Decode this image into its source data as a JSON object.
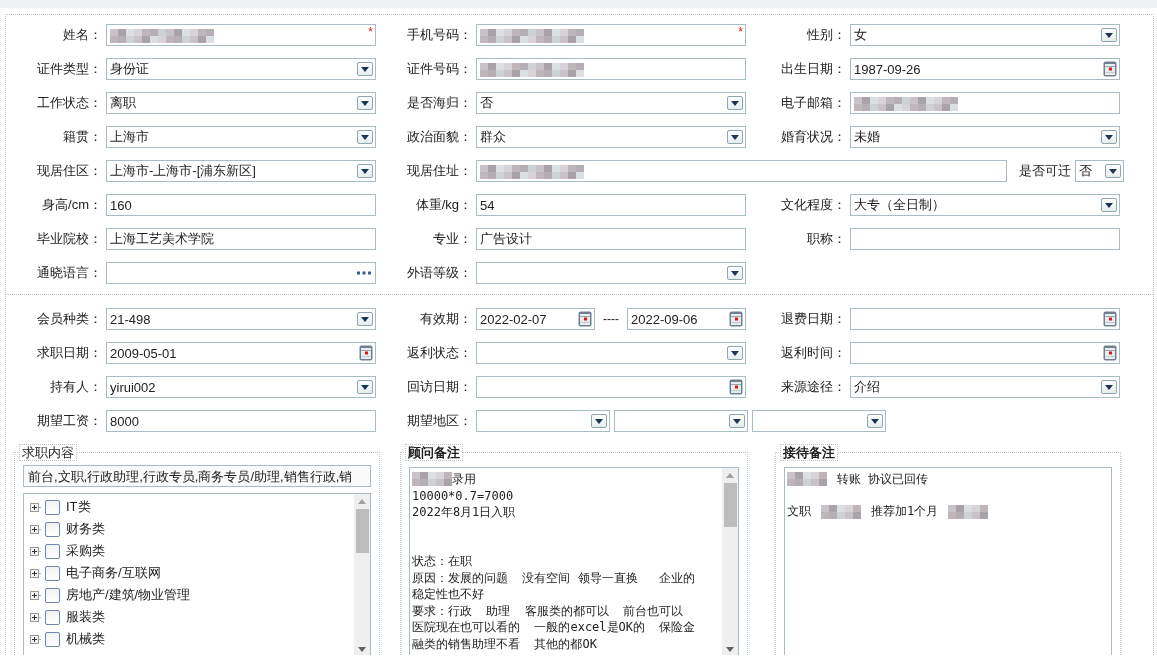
{
  "form_sections": [
    {
      "rows": [
        [
          {
            "label": "姓名：",
            "fields": [
              {
                "kind": "text",
                "redacted": true,
                "required_mark": "*"
              }
            ]
          },
          {
            "label": "手机号码：",
            "fields": [
              {
                "kind": "text",
                "redacted": true,
                "required_mark": "*"
              }
            ]
          },
          {
            "label": "性别：",
            "fields": [
              {
                "kind": "select",
                "value": "女"
              }
            ]
          }
        ],
        [
          {
            "label": "证件类型：",
            "fields": [
              {
                "kind": "select",
                "value": "身份证"
              }
            ]
          },
          {
            "label": "证件号码：",
            "fields": [
              {
                "kind": "text",
                "redacted": true
              }
            ]
          },
          {
            "label": "出生日期：",
            "fields": [
              {
                "kind": "date",
                "value": "1987-09-26"
              }
            ]
          }
        ],
        [
          {
            "label": "工作状态：",
            "fields": [
              {
                "kind": "select",
                "value": "离职"
              }
            ]
          },
          {
            "label": "是否海归：",
            "fields": [
              {
                "kind": "select",
                "value": "否"
              }
            ]
          },
          {
            "label": "电子邮箱：",
            "fields": [
              {
                "kind": "text",
                "redacted": true
              }
            ]
          }
        ],
        [
          {
            "label": "籍贯：",
            "fields": [
              {
                "kind": "select",
                "value": "上海市"
              }
            ]
          },
          {
            "label": "政治面貌：",
            "fields": [
              {
                "kind": "select",
                "value": "群众"
              }
            ]
          },
          {
            "label": "婚育状况：",
            "fields": [
              {
                "kind": "select",
                "value": "未婚"
              }
            ]
          }
        ],
        [
          {
            "label": "现居住区：",
            "fields": [
              {
                "kind": "select",
                "value": "上海市-上海市-[浦东新区]"
              }
            ]
          },
          {
            "label": "现居住址：",
            "fields": [
              {
                "kind": "text",
                "redacted": true
              }
            ],
            "trailing": {
              "label": "是否可迁",
              "fields": [
                {
                  "kind": "select",
                  "value": "否"
                }
              ]
            }
          }
        ],
        [
          {
            "label": "身高/cm：",
            "fields": [
              {
                "kind": "text",
                "value": "160"
              }
            ]
          },
          {
            "label": "体重/kg：",
            "fields": [
              {
                "kind": "text",
                "value": "54"
              }
            ]
          },
          {
            "label": "文化程度：",
            "fields": [
              {
                "kind": "select",
                "value": "大专（全日制）"
              }
            ]
          }
        ],
        [
          {
            "label": "毕业院校：",
            "fields": [
              {
                "kind": "text",
                "value": "上海工艺美术学院"
              }
            ]
          },
          {
            "label": "专业：",
            "fields": [
              {
                "kind": "text",
                "value": "广告设计"
              }
            ]
          },
          {
            "label": "职称：",
            "fields": [
              {
                "kind": "text"
              }
            ]
          }
        ],
        [
          {
            "label": "通晓语言：",
            "fields": [
              {
                "kind": "picker"
              }
            ]
          },
          {
            "label": "外语等级：",
            "fields": [
              {
                "kind": "select"
              }
            ]
          }
        ]
      ]
    },
    {
      "rows": [
        [
          {
            "label": "会员种类：",
            "fields": [
              {
                "kind": "select",
                "value": "21-498"
              }
            ]
          },
          {
            "label": "有效期：",
            "fields": [
              {
                "kind": "date",
                "value": "2022-02-07"
              },
              {
                "kind": "separator",
                "value": "----"
              },
              {
                "kind": "date",
                "value": "2022-09-06"
              }
            ]
          },
          {
            "label": "退费日期：",
            "fields": [
              {
                "kind": "date"
              }
            ]
          }
        ],
        [
          {
            "label": "求职日期：",
            "fields": [
              {
                "kind": "date",
                "value": "2009-05-01"
              }
            ]
          },
          {
            "label": "返利状态：",
            "fields": [
              {
                "kind": "select"
              }
            ]
          },
          {
            "label": "返利时间：",
            "fields": [
              {
                "kind": "date"
              }
            ]
          }
        ],
        [
          {
            "label": "持有人：",
            "fields": [
              {
                "kind": "select",
                "value": "yirui002"
              }
            ]
          },
          {
            "label": "回访日期：",
            "fields": [
              {
                "kind": "date"
              }
            ]
          },
          {
            "label": "来源途径：",
            "fields": [
              {
                "kind": "select",
                "value": "介绍"
              }
            ]
          }
        ],
        [
          {
            "label": "期望工资：",
            "fields": [
              {
                "kind": "text",
                "value": "8000"
              }
            ]
          },
          {
            "label": "期望地区：",
            "fields": [
              {
                "kind": "select"
              },
              {
                "kind": "select"
              },
              {
                "kind": "select"
              }
            ]
          }
        ]
      ]
    }
  ],
  "job_content": {
    "legend": "求职内容",
    "value": "前台,文职,行政助理,行政专员,商务专员/助理,销售行政,销",
    "tree": [
      {
        "label": "IT类",
        "expanded": false,
        "checked": false
      },
      {
        "label": "财务类",
        "expanded": false,
        "checked": false
      },
      {
        "label": "采购类",
        "expanded": false,
        "checked": false
      },
      {
        "label": "电子商务/互联网",
        "expanded": false,
        "checked": false
      },
      {
        "label": "房地产/建筑/物业管理",
        "expanded": false,
        "checked": false
      },
      {
        "label": "服装类",
        "expanded": false,
        "checked": false
      },
      {
        "label": "机械类",
        "expanded": false,
        "checked": false
      }
    ]
  },
  "advisor_notes": {
    "legend": "顾问备注",
    "paragraphs": [
      [
        [
          {
            "redacted": true
          },
          {
            "text": "录用"
          }
        ],
        [
          {
            "text": "10000*0.7=7000"
          }
        ],
        [
          {
            "text": "2022年8月1日入职"
          }
        ]
      ],
      [
        [
          {
            "text": "状态：在职"
          }
        ],
        [
          {
            "text": "原因：发展的问题  没有空间 领导一直换   企业的"
          }
        ],
        [
          {
            "text": "稳定性也不好"
          }
        ],
        [
          {
            "text": "要求：行政  助理  客服类的都可以  前台也可以"
          }
        ],
        [
          {
            "text": "医院现在也可以看的  一般的excel是OK的  保险金"
          }
        ],
        [
          {
            "text": "融类的销售助理不看  其他的都OK"
          }
        ]
      ]
    ]
  },
  "reception_notes": {
    "legend": "接待备注",
    "paragraphs": [
      [
        [
          {
            "redacted": true
          },
          {
            "text": "转账 协议已回传"
          }
        ]
      ],
      [
        [
          {
            "text": "文职"
          },
          {
            "redacted": true
          },
          {
            "text": "推荐加1个月"
          },
          {
            "redacted": true
          }
        ]
      ]
    ]
  }
}
